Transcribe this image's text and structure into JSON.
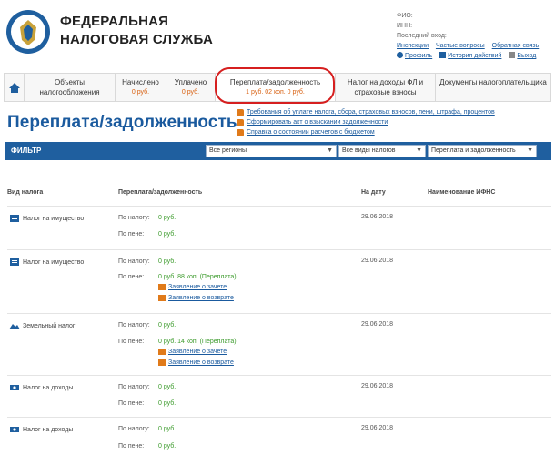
{
  "brand": {
    "line1": "ФЕДЕРАЛЬНАЯ",
    "line2": "НАЛОГОВАЯ СЛУЖБА"
  },
  "user": {
    "fio_label": "ФИО:",
    "inn_label": "ИНН:",
    "last_login_label": "Последний вход:",
    "links": [
      "Инспекции",
      "Частые вопросы",
      "Обратная связь"
    ],
    "actions": [
      "Профиль",
      "История действий",
      "Выход"
    ]
  },
  "tabs": [
    {
      "label": "Объекты налогообложения",
      "sub": ""
    },
    {
      "label": "Начислено",
      "sub": "0 руб."
    },
    {
      "label": "Уплачено",
      "sub": "0 руб."
    },
    {
      "label": "Переплата/задолженность",
      "sub": "1 руб. 02 коп. 0 руб."
    },
    {
      "label": "Налог на доходы ФЛ и страховые взносы",
      "sub": ""
    },
    {
      "label": "Документы налогоплательщика",
      "sub": ""
    }
  ],
  "page_title": "Переплата/задолженность",
  "info_links": [
    "Требования об уплате налога, сбора, страховых взносов, пени, штрафа, процентов",
    "Сформировать акт о взыскании задолженности",
    "Справка о состоянии расчетов с бюджетом"
  ],
  "filter": {
    "title": "ФИЛЬТР",
    "selects": [
      "Все регионы",
      "Все виды налогов",
      "Переплата и задолженность"
    ]
  },
  "table": {
    "headers": [
      "Вид налога",
      "Переплата/задолженность",
      "На дату",
      "Наименование ИФНС"
    ],
    "tax_label": "По налогу:",
    "penalty_label": "По пене:",
    "offset_action": "Заявление о зачете",
    "refund_action": "Заявление о возврате",
    "groups": [
      {
        "name": "Налог на имущество",
        "date": "29.06.2018",
        "tax_value": "0 руб.",
        "penalty_value": "0 руб."
      },
      {
        "name": "Налог на имущество",
        "date": "29.06.2018",
        "tax_value": "0 руб.",
        "penalty_value": "0 руб. 88 коп. (Переплата)"
      },
      {
        "name": "Земельный налог",
        "date": "29.06.2018",
        "tax_value": "0 руб.",
        "penalty_value": "0 руб. 14 коп. (Переплата)"
      },
      {
        "name": "Налог на доходы",
        "date": "29.06.2018",
        "tax_value": "0 руб.",
        "penalty_value": "0 руб."
      },
      {
        "name": "Налог на доходы",
        "date": "29.06.2018",
        "tax_value": "0 руб.",
        "penalty_value": "0 руб."
      }
    ]
  },
  "colors": {
    "accent": "#1f5f9f",
    "positive": "#3a9a2a",
    "badge": "#d86010",
    "highlight": "#d61f1f"
  },
  "icons": [
    "fns-emblem-icon",
    "home-icon",
    "property-icon",
    "land-icon",
    "income-icon",
    "document-icon",
    "offset-icon",
    "refund-icon"
  ]
}
